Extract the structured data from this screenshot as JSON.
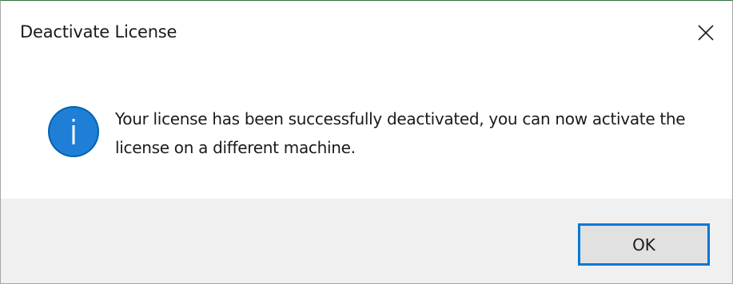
{
  "window": {
    "title": "Deactivate License",
    "close_icon": "close-icon"
  },
  "content": {
    "icon": "info-icon",
    "message": "Your license has been successfully deactivated, you can now activate the license on a different machine."
  },
  "footer": {
    "ok_label": "OK"
  },
  "colors": {
    "accent": "#0078d7",
    "footer_bg": "#f0f0f0",
    "icon_blue": "#0063b1"
  }
}
